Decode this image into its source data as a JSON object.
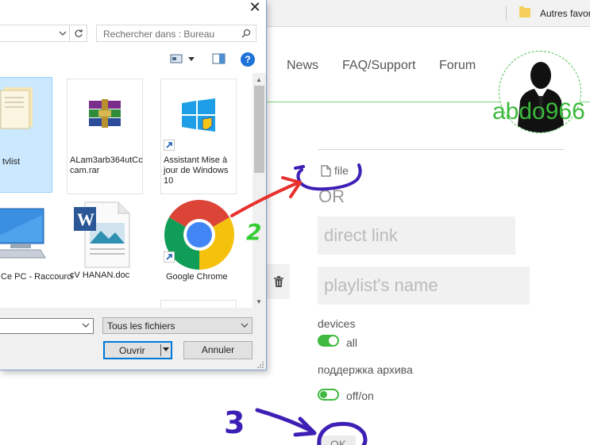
{
  "browser": {
    "bookmark_folder_label": "Autres favor"
  },
  "site": {
    "nav": {
      "news": "News",
      "faq": "FAQ/Support",
      "forum": "Forum"
    },
    "username": "abdo966",
    "form": {
      "file_label": "file",
      "or_label": "OR",
      "direct_link_placeholder": "direct link",
      "playlist_placeholder": "playlist's name",
      "devices_label": "devices",
      "devices_value": "all",
      "archive_label": "поддержка архива",
      "archive_value": "off/on",
      "ok_label": "OK"
    },
    "colors": {
      "accent": "#3fba3f",
      "annotation_blue": "#3d1fb5",
      "annotation_red": "#e8302c",
      "annotation_green": "#33cc33"
    }
  },
  "dialog": {
    "search_placeholder": "Rechercher dans : Bureau",
    "help": "?",
    "files": [
      {
        "name": "tvlist",
        "icon": "document-folder-icon"
      },
      {
        "name": "ALam3arb364utCccam.rar",
        "icon": "winrar-archive-icon"
      },
      {
        "name": "Assistant Mise à jour de Windows 10",
        "icon": "windows-logo-icon"
      },
      {
        "name": "Ce PC - Raccourci",
        "icon": "computer-monitor-icon"
      },
      {
        "name": "cV HANAN.doc",
        "icon": "word-document-icon"
      },
      {
        "name": "Google Chrome",
        "icon": "chrome-logo-icon"
      }
    ],
    "file_type_filter": "Tous les fichiers",
    "open_label": "Ouvrir",
    "cancel_label": "Annuler"
  },
  "annotations": {
    "step2": "2",
    "step3": "3"
  }
}
